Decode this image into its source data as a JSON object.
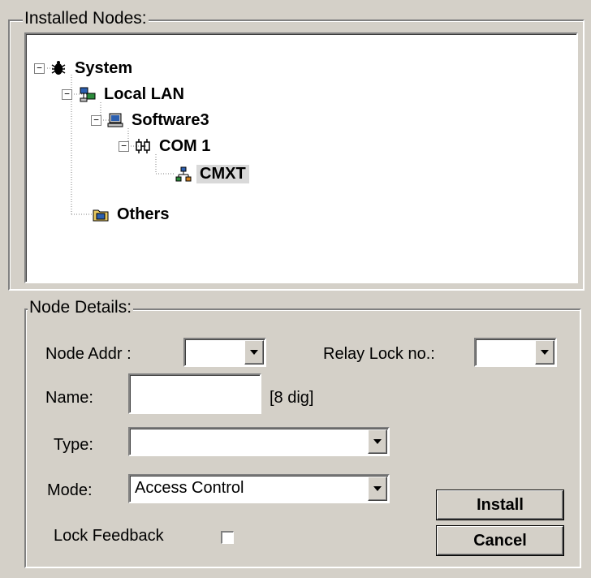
{
  "installed_nodes": {
    "title": "Installed Nodes:",
    "tree": [
      {
        "label": "System",
        "icon": "system-bug-icon"
      },
      {
        "label": "Local LAN",
        "icon": "network-icon"
      },
      {
        "label": "Software3",
        "icon": "computer-icon"
      },
      {
        "label": "COM 1",
        "icon": "port-icon"
      },
      {
        "label": "CMXT",
        "icon": "node-icon",
        "selected": true
      },
      {
        "label": "Others",
        "icon": "folder-icon"
      }
    ]
  },
  "node_details": {
    "title": "Node Details:",
    "node_addr_label": "Node Addr :",
    "node_addr_value": "",
    "relay_lock_label": "Relay Lock no.:",
    "relay_lock_value": "",
    "name_label": "Name:",
    "name_value": "",
    "name_hint": "[8 dig]",
    "type_label": "Type:",
    "type_value": "",
    "mode_label": "Mode:",
    "mode_value": "Access Control",
    "lock_feedback_label": "Lock Feedback",
    "lock_feedback_checked": false,
    "install_label": "Install",
    "cancel_label": "Cancel"
  }
}
